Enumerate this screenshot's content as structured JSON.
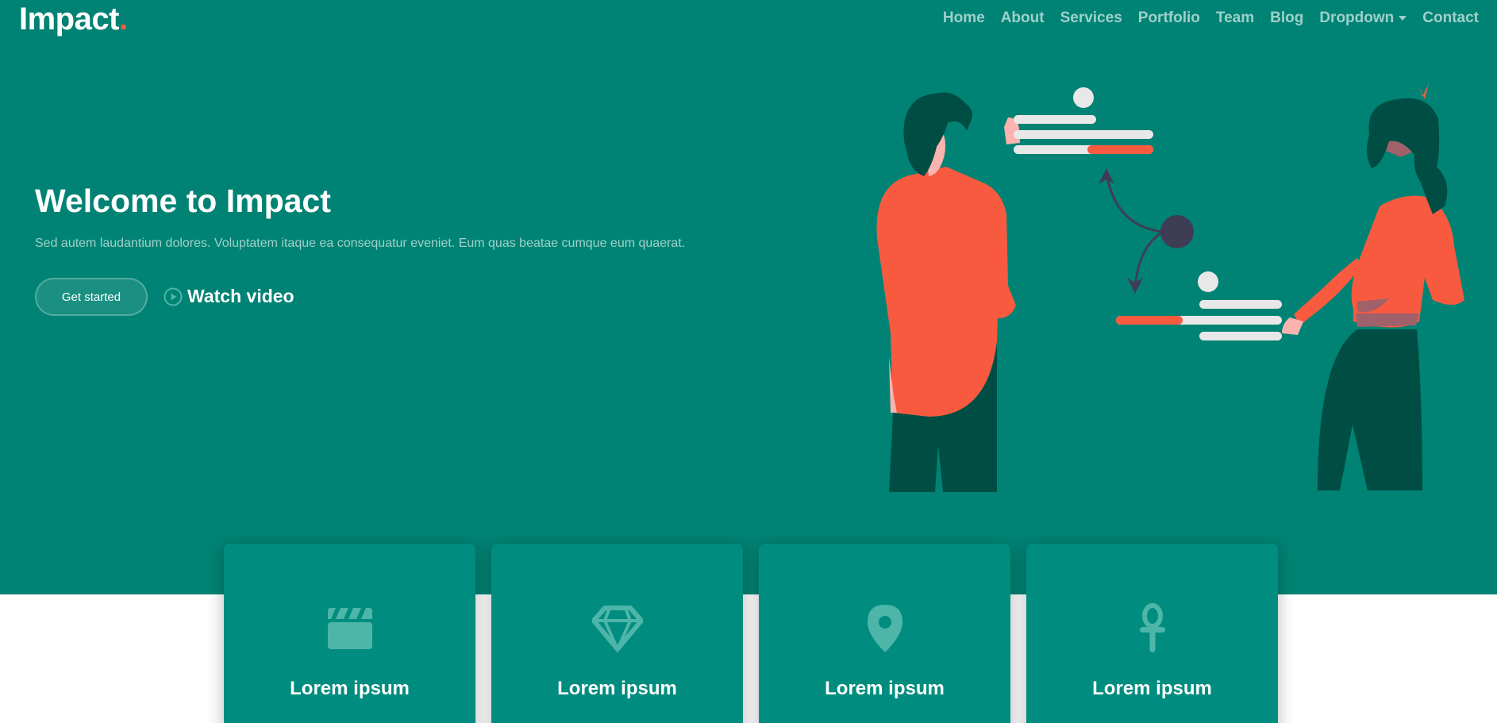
{
  "header": {
    "logo": {
      "text": "Impact",
      "dot": "."
    },
    "nav": [
      {
        "label": "Home",
        "name": "nav-home"
      },
      {
        "label": "About",
        "name": "nav-about"
      },
      {
        "label": "Services",
        "name": "nav-services"
      },
      {
        "label": "Portfolio",
        "name": "nav-portfolio"
      },
      {
        "label": "Team",
        "name": "nav-team"
      },
      {
        "label": "Blog",
        "name": "nav-blog"
      },
      {
        "label": "Dropdown",
        "name": "nav-dropdown",
        "icon": "chevron-down-icon"
      },
      {
        "label": "Contact",
        "name": "nav-contact"
      }
    ]
  },
  "hero": {
    "title": "Welcome to Impact",
    "subtitle": "Sed autem laudantium dolores. Voluptatem itaque ea consequatur eveniet. Eum quas beatae cumque eum quaerat.",
    "primary_button": "Get started",
    "video_button": {
      "label": "Watch video",
      "icon": "play-circle-icon"
    }
  },
  "cards": [
    {
      "icon": "clapperboard-icon",
      "title": "Lorem ipsum"
    },
    {
      "icon": "gem-icon",
      "title": "Lorem ipsum"
    },
    {
      "icon": "map-pin-icon",
      "title": "Lorem ipsum"
    },
    {
      "icon": "ankh-icon",
      "title": "Lorem ipsum"
    }
  ],
  "colors": {
    "primary": "#008374",
    "card": "#008d7f",
    "accent": "#f85a40",
    "dark_green": "#004d43",
    "icon_tint": "#4db6a9",
    "text_muted": "rgba(255,255,255,0.62)"
  }
}
